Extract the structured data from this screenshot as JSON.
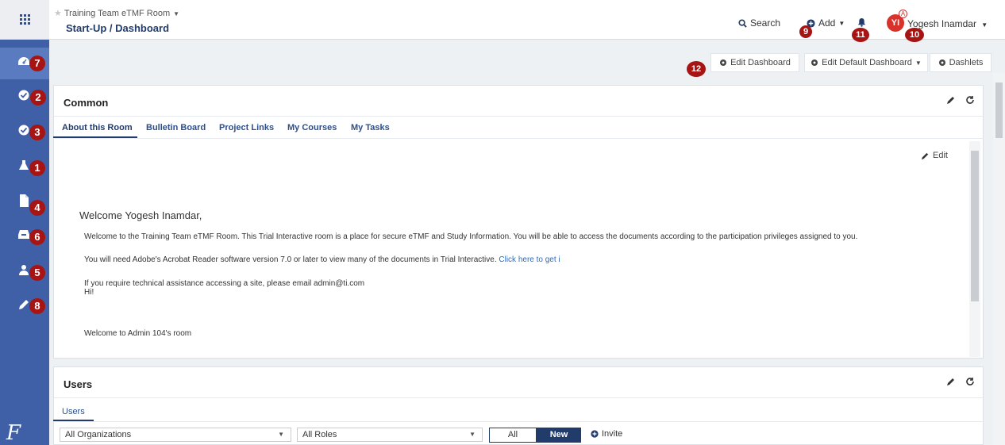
{
  "header": {
    "room_title": "Training Team eTMF Room",
    "breadcrumb": "Start-Up / Dashboard",
    "search_label": "Search",
    "add_label": "Add",
    "user_initials": "YI",
    "user_badge": "A",
    "user_name": "Yogesh Inamdar"
  },
  "sidebar": {
    "items": [
      {
        "icon": "dashboard-icon"
      },
      {
        "icon": "globe-check-icon"
      },
      {
        "icon": "check-circle-icon"
      },
      {
        "icon": "flask-icon"
      },
      {
        "icon": "document-icon"
      },
      {
        "icon": "inbox-icon"
      },
      {
        "icon": "users-icon"
      },
      {
        "icon": "pencil-icon"
      }
    ],
    "logo_text": "F"
  },
  "markers": [
    "7",
    "2",
    "3",
    "1",
    "4",
    "6",
    "5",
    "8",
    "9",
    "11",
    "10",
    "12"
  ],
  "toolbar": {
    "edit_dashboard": "Edit Dashboard",
    "edit_default_dashboard": "Edit Default Dashboard",
    "dashlets": "Dashlets"
  },
  "common_panel": {
    "title": "Common",
    "tabs": [
      "About this Room",
      "Bulletin Board",
      "Project Links",
      "My Courses",
      "My Tasks"
    ],
    "edit_label": "Edit",
    "welcome_heading": "Welcome Yogesh Inamdar,",
    "para1": "Welcome to the Training Team eTMF Room.  This Trial Interactive room is a place for secure eTMF and Study Information. You will be able to access the documents according to the participation privileges assigned to you.",
    "para2_text": "You will need Adobe's Acrobat Reader software version 7.0 or later to view many of the documents in Trial Interactive. ",
    "para2_link": "Click here to get i",
    "para3": "If you require technical assistance accessing a site, please email admin@ti.com",
    "para4": "Hi!",
    "para5": "Welcome to Admin 104's room"
  },
  "users_panel": {
    "title": "Users",
    "tab": "Users",
    "org_select": "All Organizations",
    "role_select": "All Roles",
    "toggle_all": "All",
    "toggle_new": "New",
    "invite_label": "Invite"
  }
}
